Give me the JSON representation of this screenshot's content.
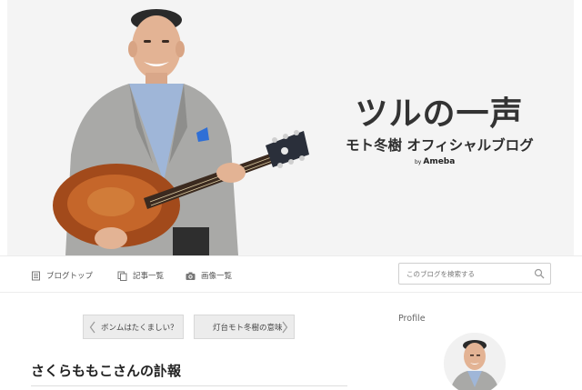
{
  "header": {
    "title": "ツルの一声",
    "subtitle": "モト冬樹 オフィシャルブログ",
    "platform_by": "by",
    "platform_name": "Ameba"
  },
  "nav": {
    "items": [
      {
        "label": "ブログトップ",
        "icon": "blog-top-icon"
      },
      {
        "label": "記事一覧",
        "icon": "article-list-icon"
      },
      {
        "label": "画像一覧",
        "icon": "camera-icon"
      }
    ],
    "search_placeholder": "このブログを検索する",
    "search_icon": "search-icon"
  },
  "pager": {
    "prev_label": "ボンムはたくましい？",
    "next_label": "灯台モト冬樹の意味"
  },
  "entry": {
    "title": "さくらももこさんの訃報"
  },
  "sidebar": {
    "profile_heading": "Profile"
  },
  "colors": {
    "banner_bg": "#f4f4f4",
    "title_text": "#333333",
    "nav_text": "#555555",
    "pager_bg": "#ececec"
  }
}
